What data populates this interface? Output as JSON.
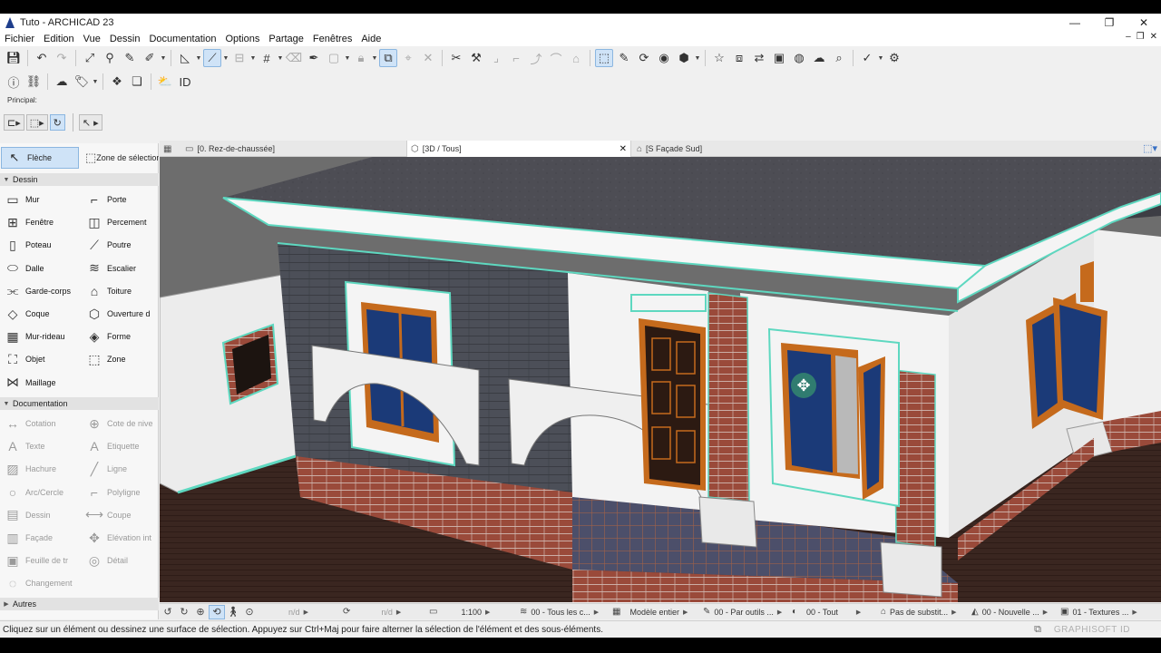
{
  "window": {
    "title": "Tuto - ARCHICAD 23",
    "controls": [
      "—",
      "❐",
      "✕"
    ]
  },
  "menu": {
    "items": [
      "Fichier",
      "Edition",
      "Vue",
      "Dessin",
      "Documentation",
      "Options",
      "Partage",
      "Fenêtres",
      "Aide"
    ],
    "mdi_controls": [
      "–",
      "❐",
      "✕"
    ]
  },
  "principal": {
    "label": "Principal:"
  },
  "toolbox": {
    "arrow_tool": "Flèche",
    "marquee_tool": "Zone de sélection",
    "sections": {
      "dessin": "Dessin",
      "documentation": "Documentation",
      "autres": "Autres"
    },
    "dessin_tools": [
      {
        "label": "Mur",
        "icon": "wall-icon",
        "glyph": "▭"
      },
      {
        "label": "Porte",
        "icon": "door-icon",
        "glyph": "⌐"
      },
      {
        "label": "Fenêtre",
        "icon": "window-icon",
        "glyph": "⊞"
      },
      {
        "label": "Percement",
        "icon": "opening-icon",
        "glyph": "◫"
      },
      {
        "label": "Poteau",
        "icon": "column-icon",
        "glyph": "▯"
      },
      {
        "label": "Poutre",
        "icon": "beam-icon",
        "glyph": "⟋"
      },
      {
        "label": "Dalle",
        "icon": "slab-icon",
        "glyph": "⬭"
      },
      {
        "label": "Escalier",
        "icon": "stair-icon",
        "glyph": "≋"
      },
      {
        "label": "Garde-corps",
        "icon": "railing-icon",
        "glyph": "⫘"
      },
      {
        "label": "Toiture",
        "icon": "roof-icon",
        "glyph": "⌂"
      },
      {
        "label": "Coque",
        "icon": "shell-icon",
        "glyph": "◇"
      },
      {
        "label": "Ouverture d",
        "icon": "skylight-icon",
        "glyph": "⬡"
      },
      {
        "label": "Mur-rideau",
        "icon": "curtain-wall-icon",
        "glyph": "▦"
      },
      {
        "label": "Forme",
        "icon": "morph-icon",
        "glyph": "◈"
      },
      {
        "label": "Objet",
        "icon": "object-icon",
        "glyph": "⛶"
      },
      {
        "label": "Zone",
        "icon": "zone-icon",
        "glyph": "⬚"
      },
      {
        "label": "Maillage",
        "icon": "mesh-icon",
        "glyph": "⋈"
      }
    ],
    "documentation_tools": [
      {
        "label": "Cotation",
        "icon": "dimension-icon",
        "glyph": "↔"
      },
      {
        "label": "Cote de nive",
        "icon": "level-dimension-icon",
        "glyph": "⊕"
      },
      {
        "label": "Texte",
        "icon": "text-icon",
        "glyph": "A"
      },
      {
        "label": "Etiquette",
        "icon": "label-icon",
        "glyph": "A"
      },
      {
        "label": "Hachure",
        "icon": "fill-icon",
        "glyph": "▨"
      },
      {
        "label": "Ligne",
        "icon": "line-icon",
        "glyph": "╱"
      },
      {
        "label": "Arc/Cercle",
        "icon": "arc-icon",
        "glyph": "○"
      },
      {
        "label": "Polyligne",
        "icon": "polyline-icon",
        "glyph": "⌐"
      },
      {
        "label": "Dessin",
        "icon": "drawing-icon",
        "glyph": "▤"
      },
      {
        "label": "Coupe",
        "icon": "section-icon",
        "glyph": "⟷"
      },
      {
        "label": "Façade",
        "icon": "elevation-icon",
        "glyph": "▥"
      },
      {
        "label": "Elévation int",
        "icon": "interior-elevation-icon",
        "glyph": "✥"
      },
      {
        "label": "Feuille de tr",
        "icon": "worksheet-icon",
        "glyph": "▣"
      },
      {
        "label": "Détail",
        "icon": "detail-icon",
        "glyph": "◎"
      },
      {
        "label": "Changement",
        "icon": "change-icon",
        "glyph": "◌"
      }
    ]
  },
  "tabs": [
    {
      "label": "[0. Rez-de-chaussée]",
      "icon": "floor-plan-icon"
    },
    {
      "label": "[3D / Tous]",
      "icon": "3d-window-icon",
      "close": "✕"
    },
    {
      "label": "[S Façade Sud]",
      "icon": "elevation-tab-icon"
    }
  ],
  "navbar": {
    "nd1": "n/d",
    "nd2": "n/d",
    "scale": "1:100",
    "layer_combo": "00 - Tous les c...",
    "model_view": "Modèle entier",
    "pen_set": "00 - Par outils ...",
    "graphic_override": "00 - Tout",
    "renovation": "Pas de substit...",
    "structure": "00 - Nouvelle ...",
    "texture": "01 - Textures ..."
  },
  "status": {
    "text": "Cliquez sur un élément ou dessinez une surface de sélection. Appuyez sur Ctrl+Maj pour faire alterner la sélection de l'élément et des sous-éléments.",
    "brand": "GRAPHISOFT ID"
  },
  "colors": {
    "selection_highlight": "#cfe3f7",
    "selection_outline": "#5ed8c0",
    "roof": "#4b4b52",
    "wall_white": "#f2f2f2",
    "wall_slate": "#4c4f58",
    "brick": "#9a4a3a",
    "floor": "#3a2620",
    "window_glass": "#1b3a78",
    "wood_frame": "#c56a1c"
  }
}
